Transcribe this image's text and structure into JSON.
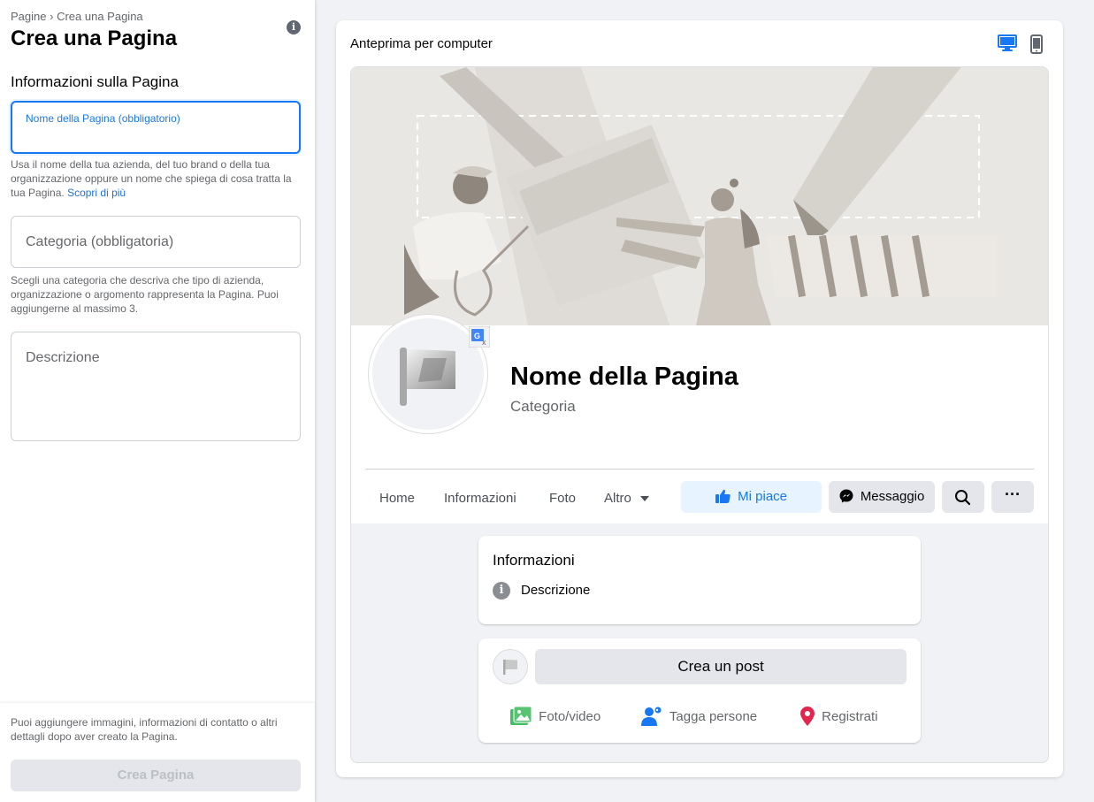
{
  "breadcrumb": {
    "parent": "Pagine",
    "separator": "›",
    "current": "Crea una Pagina"
  },
  "title": "Crea una Pagina",
  "section_title": "Informazioni sulla Pagina",
  "fields": {
    "name_label": "Nome della Pagina (obbligatorio)",
    "name_value": "",
    "name_help": "Usa il nome della tua azienda, del tuo brand o della tua organizzazione oppure un nome che spiega di cosa tratta la tua Pagina.",
    "name_help_link": "Scopri di più",
    "category_placeholder": "Categoria (obbligatoria)",
    "category_help": "Scegli una categoria che descriva che tipo di azienda, organizzazione o argomento rappresenta la Pagina. Puoi aggiungerne al massimo 3.",
    "description_placeholder": "Descrizione"
  },
  "footer": {
    "note": "Puoi aggiungere immagini, informazioni di contatto o altri dettagli dopo aver creato la Pagina.",
    "create_button": "Crea Pagina"
  },
  "preview": {
    "title": "Anteprima per computer",
    "selected_device": "desktop",
    "page_name": "Nome della Pagina",
    "page_category": "Categoria",
    "nav": [
      "Home",
      "Informazioni",
      "Foto",
      "Altro"
    ],
    "like_button": "Mi piace",
    "message_button": "Messaggio",
    "info_card": {
      "title": "Informazioni",
      "description": "Descrizione"
    },
    "post_card": {
      "create_post": "Crea un post",
      "actions": [
        "Foto/video",
        "Tagga persone",
        "Registrati"
      ]
    }
  },
  "colors": {
    "accent": "#1877f2",
    "like_bg": "#e7f3ff",
    "button_bg": "#e4e6eb",
    "disabled_text": "#bcc0c4"
  }
}
